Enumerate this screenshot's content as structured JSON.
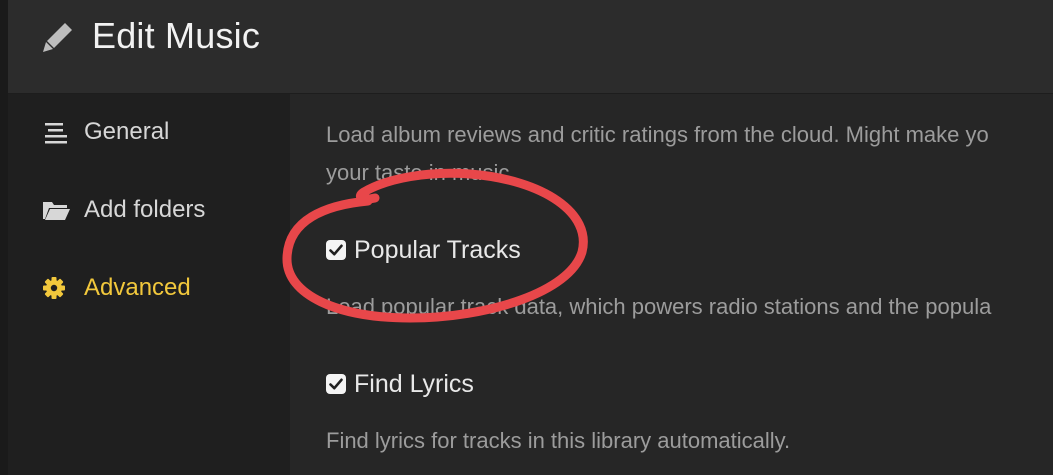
{
  "window": {
    "title": "Edit Music",
    "title_icon": "pencil-icon"
  },
  "sidebar": {
    "items": [
      {
        "label": "General",
        "icon": "align-lines-icon",
        "active": false
      },
      {
        "label": "Add folders",
        "icon": "folder-open-icon",
        "active": false
      },
      {
        "label": "Advanced",
        "icon": "gear-icon",
        "active": true
      }
    ]
  },
  "main": {
    "intro_description_line1": "Load album reviews and critic ratings from the cloud. Might make yo",
    "intro_description_line2": "your taste in music.",
    "options": [
      {
        "label": "Popular Tracks",
        "checked": true,
        "description": "Load popular track data, which powers radio stations and the popula"
      },
      {
        "label": "Find Lyrics",
        "checked": true,
        "description": "Find lyrics for tracks in this library automatically."
      }
    ]
  },
  "annotation": {
    "type": "hand-drawn red circle around Popular Tracks",
    "color": "#e8474a"
  },
  "colors": {
    "accent": "#f2c83c",
    "checkbox": "#f4f4f4",
    "annotation": "#e8474a"
  }
}
